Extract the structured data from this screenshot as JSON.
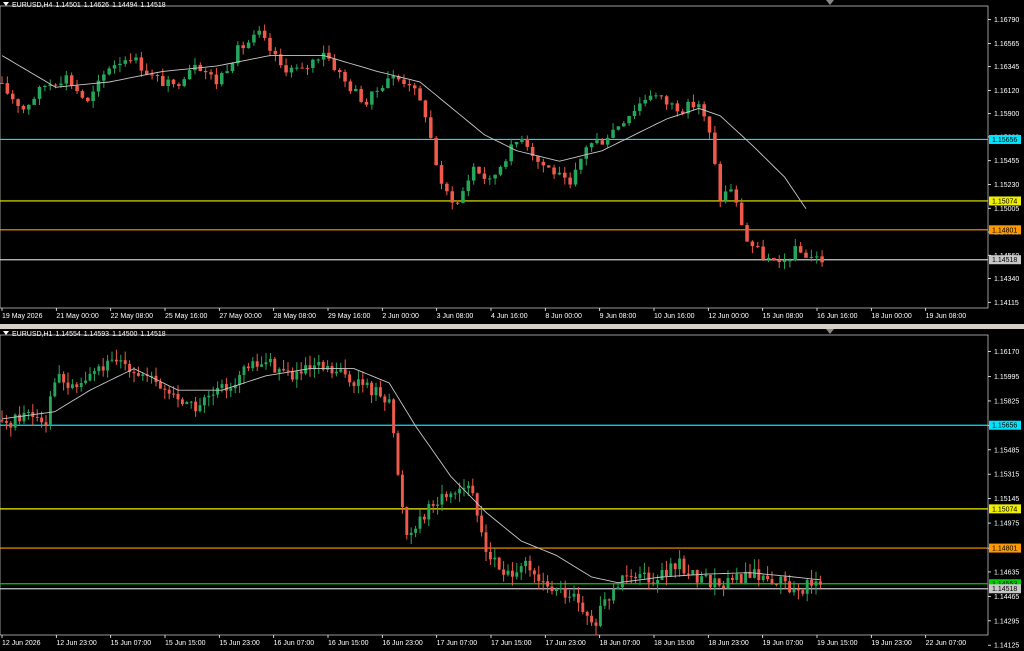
{
  "colors": {
    "background": "#000000",
    "bull": "#26a65b",
    "bear": "#ef5a4a",
    "ma": "#c8c8c8",
    "axis": "#ffffff",
    "level_cyan": "#00e5ff",
    "level_yellow": "#f0f000",
    "level_orange": "#ff9900",
    "level_current": "#c8c8c8",
    "level_green": "#00d000"
  },
  "panels": [
    {
      "header": {
        "symbol": "EURUSD,H4",
        "open": "1.14501",
        "high": "1.14626",
        "low": "1.14494",
        "close": "1.14518"
      }
    },
    {
      "header": {
        "symbol": "EURUSD,H1",
        "open": "1.14554",
        "high": "1.14593",
        "low": "1.14500",
        "close": "1.14518"
      }
    }
  ],
  "chart_data": [
    {
      "type": "candlestick",
      "title": "EURUSD,H4",
      "ylim": [
        1.1408,
        1.169
      ],
      "y_ticks": [
        "1.16790",
        "1.16565",
        "1.16345",
        "1.16120",
        "1.15900",
        "1.15680",
        "1.15455",
        "1.15230",
        "1.15005",
        "1.14780",
        "1.14560",
        "1.14340",
        "1.14115"
      ],
      "x_labels": [
        "19 May 2026",
        "21 May 00:00",
        "22 May 08:00",
        "25 May 16:00",
        "27 May 00:00",
        "28 May 08:00",
        "29 May 16:00",
        "2 Jun 00:00",
        "3 Jun 08:00",
        "4 Jun 16:00",
        "8 Jun 00:00",
        "9 Jun 08:00",
        "10 Jun 16:00",
        "12 Jun 00:00",
        "15 Jun 08:00",
        "16 Jun 16:00",
        "18 Jun 00:00",
        "19 Jun 08:00"
      ],
      "levels": [
        {
          "value": 1.15656,
          "label": "1.15656",
          "color": "#00e5ff"
        },
        {
          "value": 1.15074,
          "label": "1.15074",
          "color": "#f0f000"
        },
        {
          "value": 1.14801,
          "label": "1.14801",
          "color": "#ff9900"
        },
        {
          "value": 1.14518,
          "label": "1.14518",
          "color": "#c8c8c8"
        }
      ],
      "close_path": [
        [
          0,
          1.1615
        ],
        [
          4,
          1.1595
        ],
        [
          8,
          1.1617
        ],
        [
          12,
          1.1625
        ],
        [
          16,
          1.16
        ],
        [
          20,
          1.1635
        ],
        [
          24,
          1.1645
        ],
        [
          28,
          1.1625
        ],
        [
          32,
          1.1615
        ],
        [
          36,
          1.164
        ],
        [
          40,
          1.162
        ],
        [
          44,
          1.165
        ],
        [
          48,
          1.1665
        ],
        [
          52,
          1.1635
        ],
        [
          56,
          1.163
        ],
        [
          60,
          1.165
        ],
        [
          64,
          1.162
        ],
        [
          68,
          1.16
        ],
        [
          72,
          1.1625
        ],
        [
          76,
          1.162
        ],
        [
          79,
          1.159
        ],
        [
          82,
          1.152
        ],
        [
          85,
          1.1505
        ],
        [
          88,
          1.154
        ],
        [
          91,
          1.1525
        ],
        [
          94,
          1.155
        ],
        [
          97,
          1.157
        ],
        [
          100,
          1.1545
        ],
        [
          103,
          1.1535
        ],
        [
          106,
          1.152
        ],
        [
          109,
          1.156
        ],
        [
          112,
          1.1565
        ],
        [
          115,
          1.158
        ],
        [
          118,
          1.1595
        ],
        [
          121,
          1.161
        ],
        [
          124,
          1.16
        ],
        [
          127,
          1.1595
        ],
        [
          130,
          1.16
        ],
        [
          132,
          1.157
        ],
        [
          134,
          1.151
        ],
        [
          136,
          1.152
        ],
        [
          139,
          1.147
        ],
        [
          142,
          1.1455
        ],
        [
          145,
          1.1445
        ],
        [
          148,
          1.146
        ],
        [
          151,
          1.1455
        ],
        [
          153,
          1.14518
        ]
      ],
      "ma_path": [
        [
          0,
          1.1645
        ],
        [
          10,
          1.1615
        ],
        [
          20,
          1.162
        ],
        [
          30,
          1.163
        ],
        [
          40,
          1.1635
        ],
        [
          50,
          1.1645
        ],
        [
          60,
          1.1645
        ],
        [
          70,
          1.163
        ],
        [
          78,
          1.162
        ],
        [
          84,
          1.1595
        ],
        [
          90,
          1.157
        ],
        [
          96,
          1.1555
        ],
        [
          104,
          1.1545
        ],
        [
          112,
          1.1555
        ],
        [
          118,
          1.157
        ],
        [
          124,
          1.1585
        ],
        [
          130,
          1.1595
        ],
        [
          134,
          1.1588
        ],
        [
          140,
          1.156
        ],
        [
          146,
          1.153
        ],
        [
          150,
          1.15
        ]
      ]
    },
    {
      "type": "candlestick",
      "title": "EURUSD,H1",
      "ylim": [
        1.1421,
        1.1627
      ],
      "y_ticks": [
        "1.16170",
        "1.15995",
        "1.15825",
        "1.15655",
        "1.15485",
        "1.15315",
        "1.15145",
        "1.14975",
        "1.14800",
        "1.14635",
        "1.14465",
        "1.14295",
        "1.14125"
      ],
      "x_labels": [
        "12 Jun 2026",
        "12 Jun 23:00",
        "15 Jun 07:00",
        "15 Jun 15:00",
        "15 Jun 23:00",
        "16 Jun 07:00",
        "16 Jun 15:00",
        "16 Jun 23:00",
        "17 Jun 07:00",
        "17 Jun 15:00",
        "17 Jun 23:00",
        "18 Jun 07:00",
        "18 Jun 15:00",
        "18 Jun 23:00",
        "19 Jun 07:00",
        "19 Jun 15:00",
        "19 Jun 23:00",
        "22 Jun 07:00"
      ],
      "levels": [
        {
          "value": 1.15656,
          "label": "1.15656",
          "color": "#00e5ff"
        },
        {
          "value": 1.15074,
          "label": "1.15074",
          "color": "#f0f000"
        },
        {
          "value": 1.14801,
          "label": "1.14801",
          "color": "#ff9900"
        },
        {
          "value": 1.14553,
          "label": "1.14553",
          "color": "#00d000"
        },
        {
          "value": 1.14518,
          "label": "1.14518",
          "color": "#c8c8c8"
        }
      ],
      "close_path": [
        [
          0,
          1.1565
        ],
        [
          6,
          1.1575
        ],
        [
          10,
          1.157
        ],
        [
          12,
          1.16
        ],
        [
          16,
          1.159
        ],
        [
          22,
          1.1605
        ],
        [
          28,
          1.161
        ],
        [
          32,
          1.16
        ],
        [
          38,
          1.1588
        ],
        [
          44,
          1.1578
        ],
        [
          50,
          1.159
        ],
        [
          56,
          1.1605
        ],
        [
          60,
          1.161
        ],
        [
          66,
          1.16
        ],
        [
          72,
          1.1605
        ],
        [
          78,
          1.16
        ],
        [
          84,
          1.159
        ],
        [
          88,
          1.1585
        ],
        [
          90,
          1.153
        ],
        [
          92,
          1.149
        ],
        [
          96,
          1.1505
        ],
        [
          102,
          1.152
        ],
        [
          106,
          1.1525
        ],
        [
          110,
          1.148
        ],
        [
          114,
          1.146
        ],
        [
          118,
          1.147
        ],
        [
          122,
          1.1455
        ],
        [
          126,
          1.145
        ],
        [
          130,
          1.1445
        ],
        [
          134,
          1.1425
        ],
        [
          138,
          1.1445
        ],
        [
          142,
          1.1465
        ],
        [
          148,
          1.146
        ],
        [
          154,
          1.1468
        ],
        [
          158,
          1.146
        ],
        [
          164,
          1.1455
        ],
        [
          170,
          1.1462
        ],
        [
          176,
          1.1458
        ],
        [
          180,
          1.145
        ],
        [
          184,
          1.1456
        ],
        [
          186,
          1.14518
        ]
      ],
      "ma_path": [
        [
          0,
          1.157
        ],
        [
          12,
          1.1575
        ],
        [
          20,
          1.159
        ],
        [
          30,
          1.1605
        ],
        [
          40,
          1.159
        ],
        [
          50,
          1.159
        ],
        [
          60,
          1.16
        ],
        [
          70,
          1.1605
        ],
        [
          80,
          1.1605
        ],
        [
          88,
          1.1595
        ],
        [
          94,
          1.1565
        ],
        [
          102,
          1.153
        ],
        [
          110,
          1.1505
        ],
        [
          118,
          1.1485
        ],
        [
          126,
          1.1475
        ],
        [
          134,
          1.146
        ],
        [
          140,
          1.1456
        ],
        [
          150,
          1.146
        ],
        [
          160,
          1.1462
        ],
        [
          170,
          1.1463
        ],
        [
          180,
          1.146
        ],
        [
          186,
          1.1458
        ]
      ]
    }
  ]
}
